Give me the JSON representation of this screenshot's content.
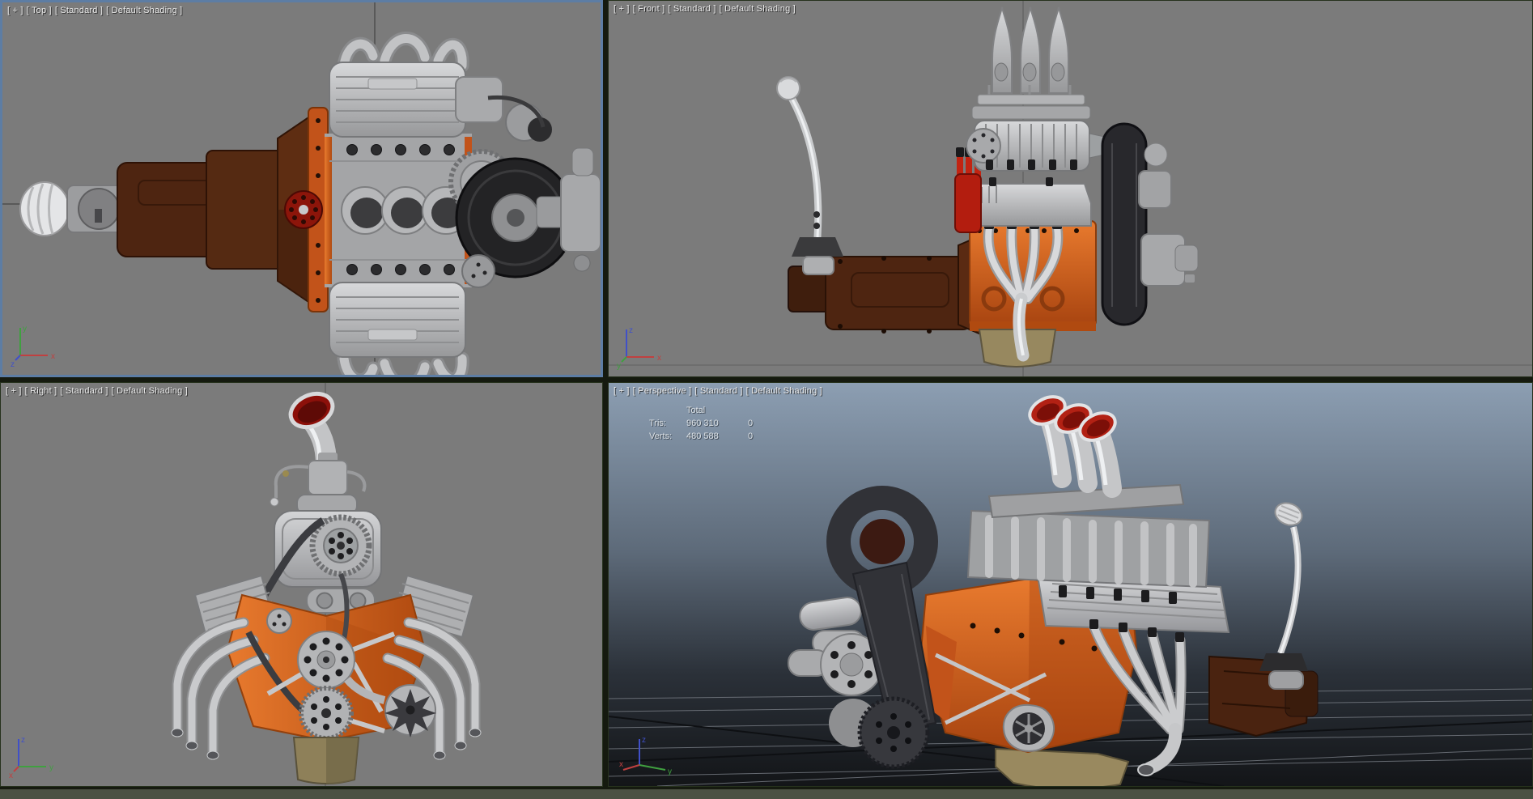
{
  "window": {
    "title": "3ds Max quad viewport - supercharged V8 engine scene"
  },
  "colors": {
    "viewport_background": "#7b7b7b",
    "active_viewport_border": "#5d7da4",
    "viewport_divider": "#151a0f",
    "perspective_sky_top": "#8c9eb2",
    "perspective_ground_bottom": "#131518",
    "engine_gray": "#b0b1b3",
    "engine_orange": "#d2601e",
    "transmission_brown": "#4a2310",
    "belt_black": "#2a2b2f",
    "stack_red": "#b22114",
    "oil_pan_tan": "#99895f",
    "axis_x": "#c04040",
    "axis_y": "#40a040",
    "axis_z": "#4050c8"
  },
  "viewports": [
    {
      "id": "top",
      "active": true,
      "label_segments": [
        "[ + ]",
        "[ Top ]",
        "[ Standard ]",
        "[ Default Shading ]"
      ],
      "gizmo": {
        "up": "y",
        "right": "x",
        "depth": "z"
      }
    },
    {
      "id": "front",
      "active": false,
      "label_segments": [
        "[ + ]",
        "[ Front ]",
        "[ Standard ]",
        "[ Default Shading ]"
      ],
      "gizmo": {
        "up": "z",
        "right": "x",
        "depth": "y"
      }
    },
    {
      "id": "right",
      "active": false,
      "label_segments": [
        "[ + ]",
        "[ Right ]",
        "[ Standard ]",
        "[ Default Shading ]"
      ],
      "gizmo": {
        "up": "z",
        "right": "y",
        "depth": "x"
      }
    },
    {
      "id": "perspective",
      "active": false,
      "label_segments": [
        "[ + ]",
        "[ Perspective ]",
        "[ Standard ]",
        "[ Default Shading ]"
      ],
      "gizmo": {
        "up": "z",
        "right": "y",
        "depth": "x"
      },
      "stats": {
        "header": "Total",
        "rows": [
          {
            "label": "Tris:",
            "total": "960 310",
            "selected": "0"
          },
          {
            "label": "Verts:",
            "total": "480 588",
            "selected": "0"
          }
        ]
      }
    }
  ]
}
